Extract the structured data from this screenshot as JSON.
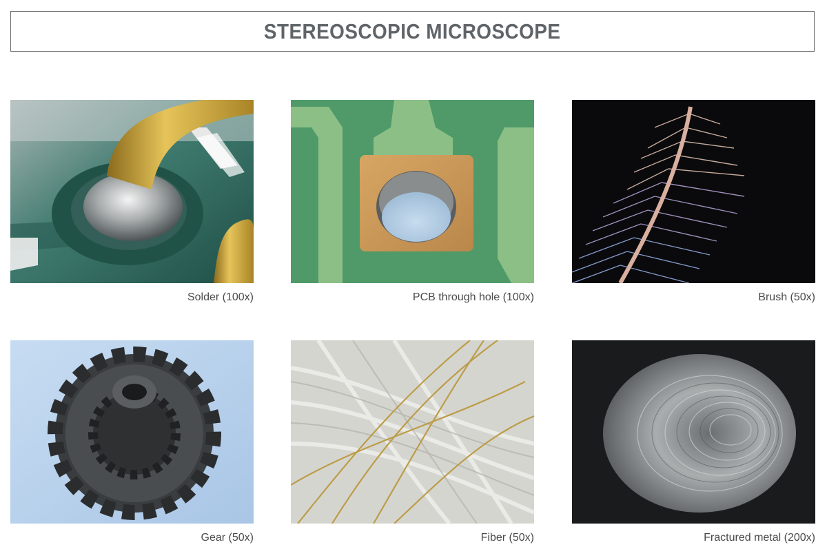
{
  "header": {
    "title": "STEREOSCOPIC MICROSCOPE"
  },
  "gallery": {
    "items": [
      {
        "caption": "Solder (100x)",
        "image": "solder-photo"
      },
      {
        "caption": "PCB through hole (100x)",
        "image": "pcb-through-hole-photo"
      },
      {
        "caption": "Brush (50x)",
        "image": "brush-photo"
      },
      {
        "caption": "Gear (50x)",
        "image": "gear-photo"
      },
      {
        "caption": "Fiber (50x)",
        "image": "fiber-photo"
      },
      {
        "caption": "Fractured metal (200x)",
        "image": "fractured-metal-photo"
      }
    ]
  },
  "colors": {
    "title_text": "#5f6468",
    "title_border": "#6e6e6e",
    "caption_text": "#4a4a4a",
    "background": "#ffffff"
  }
}
